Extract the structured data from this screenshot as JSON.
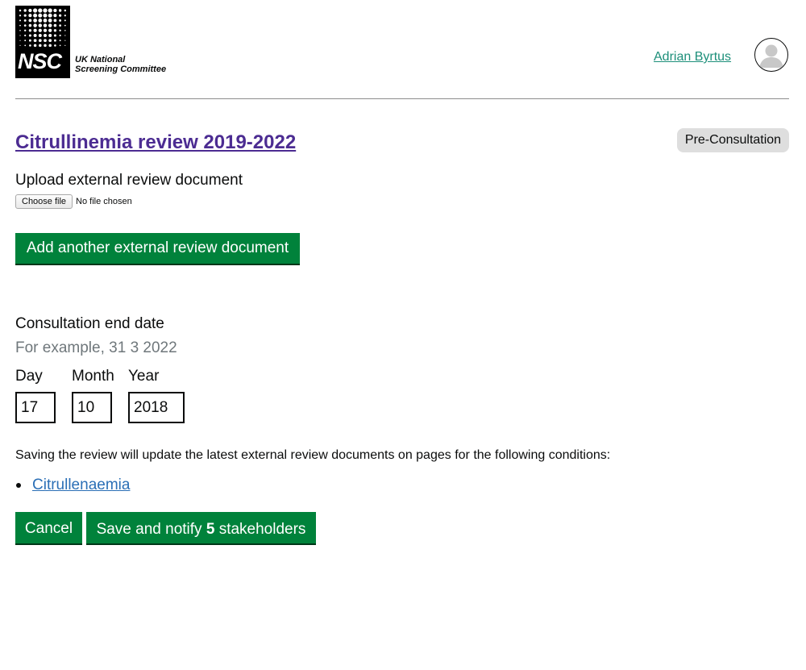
{
  "header": {
    "logo_mark": "NSC",
    "logo_text_line1": "UK National",
    "logo_text_line2": "Screening Committee",
    "user_name": "Adrian Byrtus"
  },
  "review": {
    "title": "Citrullinemia review 2019-2022",
    "status": "Pre-Consultation"
  },
  "upload": {
    "label": "Upload external review document",
    "choose_file_label": "Choose file",
    "no_file_text": "No file chosen",
    "add_another_label": "Add another external review document"
  },
  "consultation_date": {
    "label": "Consultation end date",
    "hint": "For example, 31 3 2022",
    "day_label": "Day",
    "month_label": "Month",
    "year_label": "Year",
    "day_value": "17",
    "month_value": "10",
    "year_value": "2018"
  },
  "info": {
    "text": "Saving the review will update the latest external review documents on pages for the following conditions:",
    "conditions": [
      "Citrullenaemia"
    ]
  },
  "actions": {
    "cancel_label": "Cancel",
    "save_prefix": "Save and notify",
    "stakeholder_count": "5",
    "save_suffix": "stakeholders"
  },
  "colors": {
    "button_green": "#00823b",
    "title_purple": "#4c2c92",
    "user_link_teal": "#1d8f7a",
    "condition_link_blue": "#2b6fb6",
    "badge_grey": "#dedede",
    "hint_grey": "#6f777b"
  },
  "icons": {
    "avatar": "user-avatar-icon",
    "logo": "nsc-logo"
  }
}
